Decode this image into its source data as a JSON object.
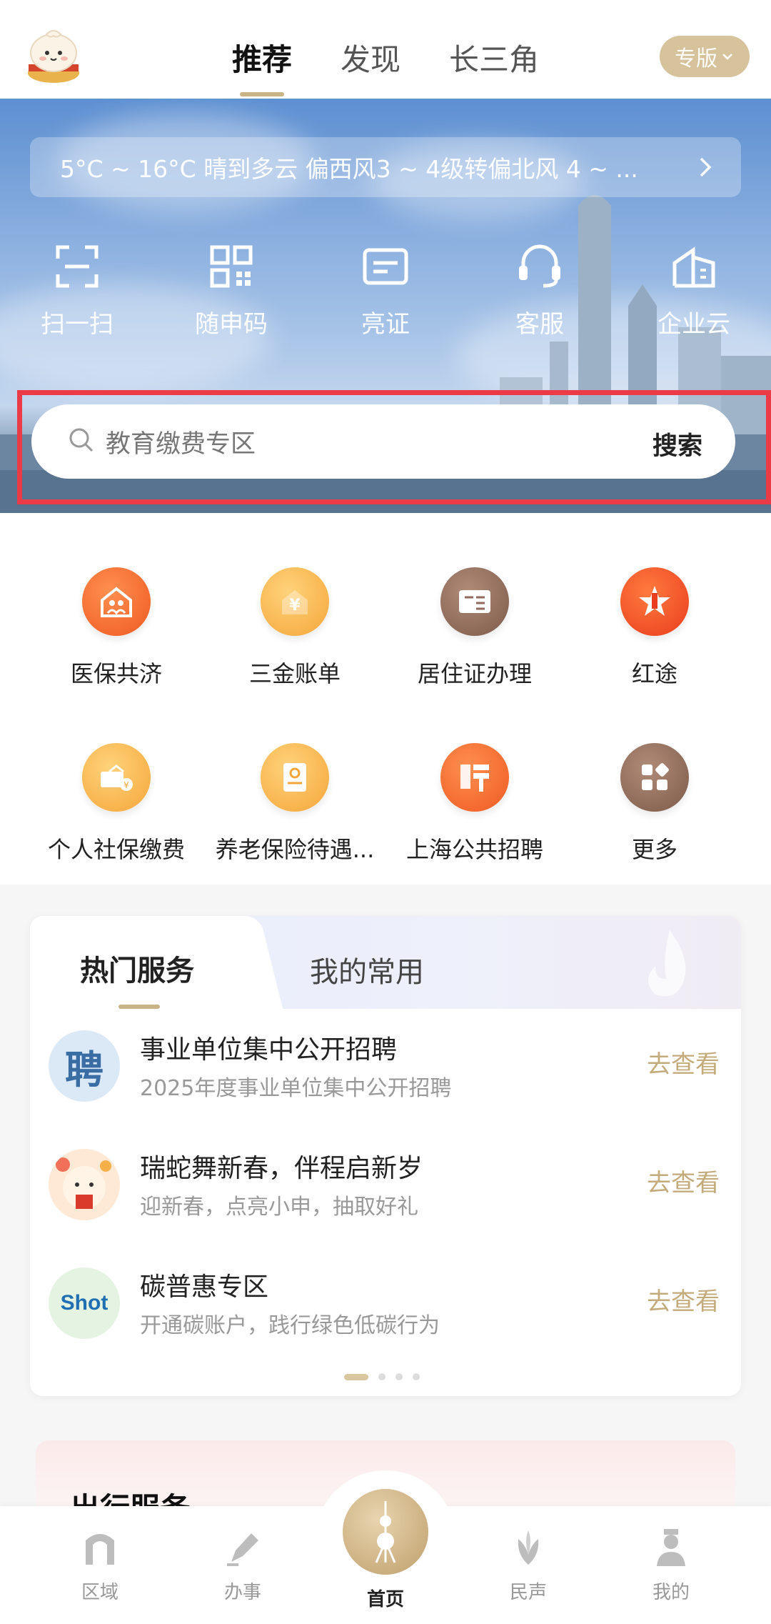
{
  "top_tabs": {
    "recommend": "推荐",
    "discover": "发现",
    "yangtze": "长三角"
  },
  "edition_button": "专版",
  "weather": {
    "text": "5°C ~ 16°C   晴到多云   偏西风3 ~ 4级转偏北风  4 ~ ..."
  },
  "quick_actions": [
    {
      "label": "扫一扫",
      "icon": "scan-icon"
    },
    {
      "label": "随申码",
      "icon": "qr-code-icon"
    },
    {
      "label": "亮证",
      "icon": "id-card-icon"
    },
    {
      "label": "客服",
      "icon": "headset-icon"
    },
    {
      "label": "企业云",
      "icon": "building-icon"
    }
  ],
  "search": {
    "placeholder": "教育缴费专区",
    "button": "搜索"
  },
  "services": [
    {
      "label": "医保共济",
      "icon": "family-house-icon",
      "color": "#f06a2b"
    },
    {
      "label": "三金账单",
      "icon": "yuan-coin-icon",
      "color": "#f7b043"
    },
    {
      "label": "居住证办理",
      "icon": "residence-card-icon",
      "color": "#8f6a58"
    },
    {
      "label": "红途",
      "icon": "red-star-icon",
      "color": "#f1502b"
    },
    {
      "label": "个人社保缴费",
      "icon": "social-insurance-icon",
      "color": "#f7b043"
    },
    {
      "label": "养老保险待遇...",
      "icon": "pension-doc-icon",
      "color": "#f7b043"
    },
    {
      "label": "上海公共招聘",
      "icon": "recruit-icon",
      "color": "#f06a2b"
    },
    {
      "label": "更多",
      "icon": "grid-more-icon",
      "color": "#8f6a58"
    }
  ],
  "hot_card": {
    "tab_hot": "热门服务",
    "tab_mine": "我的常用",
    "items": [
      {
        "title": "事业单位集中公开招聘",
        "subtitle": "2025年度事业单位集中公开招聘",
        "action": "去查看"
      },
      {
        "title": "瑞蛇舞新春，伴程启新岁",
        "subtitle": "迎新春，点亮小申，抽取好礼",
        "action": "去查看"
      },
      {
        "title": "碳普惠专区",
        "subtitle": "开通碳账户，践行绿色低碳行为",
        "action": "去查看"
      }
    ],
    "thumb_texts": {
      "recruit": "聘",
      "carbon": "Shot"
    }
  },
  "travel_card": {
    "title": "出行服务"
  },
  "bottom_nav": {
    "region": "区域",
    "affairs": "办事",
    "home": "首页",
    "voice": "民声",
    "mine": "我的"
  }
}
